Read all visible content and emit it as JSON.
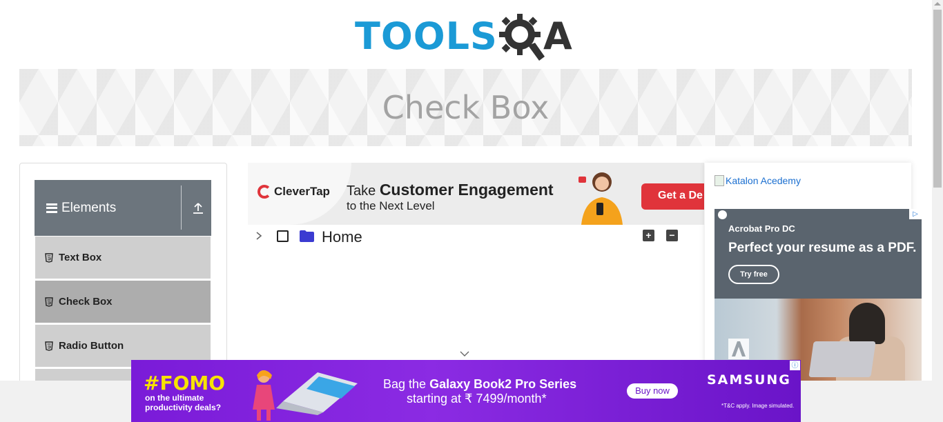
{
  "header": {
    "logo_text_primary": "TOOLS",
    "logo_text_secondary": "A",
    "brand_color": "#1b9ad6"
  },
  "banner": {
    "title": "Check Box"
  },
  "sidebar": {
    "group_title": "Elements",
    "items": [
      {
        "label": "Text Box",
        "active": false
      },
      {
        "label": "Check Box",
        "active": true
      },
      {
        "label": "Radio Button",
        "active": false
      }
    ]
  },
  "ads": {
    "top": {
      "brand": "CleverTap",
      "line1_prefix": "Take",
      "line1_bold": "Customer Engagement",
      "line2": "to the Next Level",
      "cta": "Get a De"
    },
    "right": {
      "katalon_alt": "Katalon Acedemy",
      "adobe_product": "Acrobat Pro DC",
      "adobe_headline": "Perfect your resume as a PDF.",
      "adobe_cta": "Try free"
    },
    "bottom": {
      "fomo": "#FOMO",
      "fomo_sub_1": "on the ultimate",
      "fomo_sub_2": "productivity deals?",
      "line1_prefix": "Bag the",
      "line1_bold": "Galaxy Book2 Pro Series",
      "line2": "starting at ₹ 7499/month*",
      "cta": "Buy now",
      "brand": "SAMSUNG",
      "terms": "*T&C apply. Image simulated."
    }
  },
  "tree": {
    "root_label": "Home",
    "expand_all": "+",
    "collapse_all": "−"
  },
  "icons": [
    "hamburger-icon",
    "upload-icon",
    "html5-icon",
    "chevron-right-icon",
    "folder-icon",
    "chevron-down-icon",
    "info-icon",
    "adobe-choices-icon",
    "adobe-logo-icon"
  ]
}
